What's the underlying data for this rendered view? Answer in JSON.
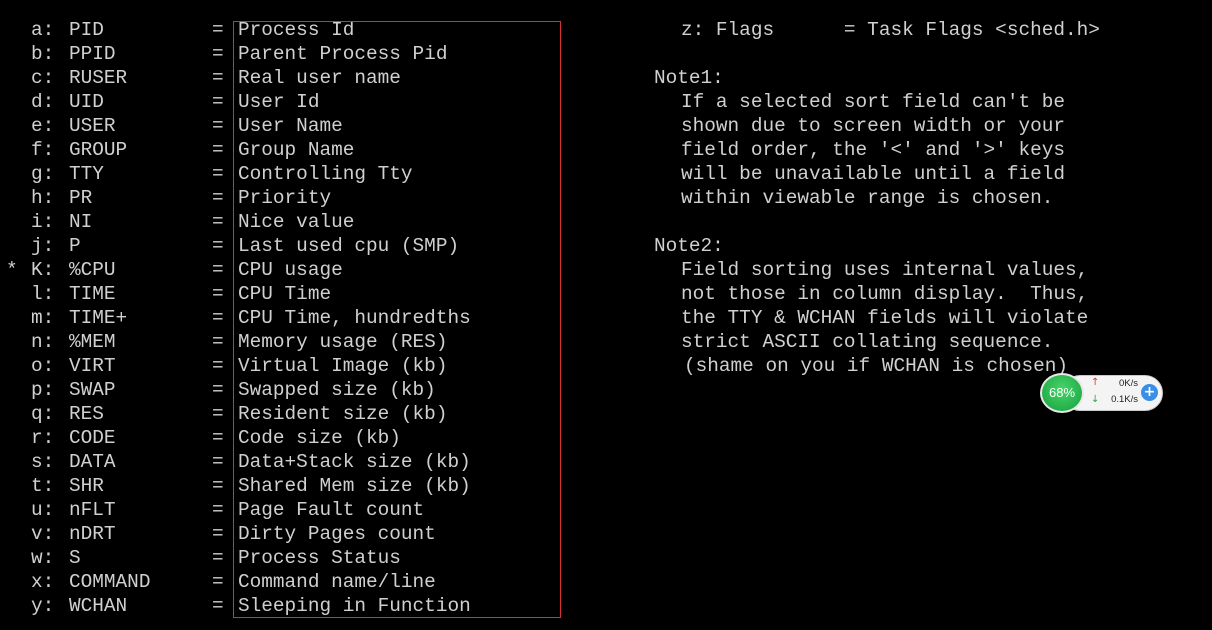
{
  "fields": [
    {
      "mark": "",
      "key": "a:",
      "name": "PID",
      "eq": "=",
      "desc": "Process Id"
    },
    {
      "mark": "",
      "key": "b:",
      "name": "PPID",
      "eq": "=",
      "desc": "Parent Process Pid"
    },
    {
      "mark": "",
      "key": "c:",
      "name": "RUSER",
      "eq": "=",
      "desc": "Real user name"
    },
    {
      "mark": "",
      "key": "d:",
      "name": "UID",
      "eq": "=",
      "desc": "User Id"
    },
    {
      "mark": "",
      "key": "e:",
      "name": "USER",
      "eq": "=",
      "desc": "User Name"
    },
    {
      "mark": "",
      "key": "f:",
      "name": "GROUP",
      "eq": "=",
      "desc": "Group Name"
    },
    {
      "mark": "",
      "key": "g:",
      "name": "TTY",
      "eq": "=",
      "desc": "Controlling Tty"
    },
    {
      "mark": "",
      "key": "h:",
      "name": "PR",
      "eq": "=",
      "desc": "Priority"
    },
    {
      "mark": "",
      "key": "i:",
      "name": "NI",
      "eq": "=",
      "desc": "Nice value"
    },
    {
      "mark": "",
      "key": "j:",
      "name": "P",
      "eq": "=",
      "desc": "Last used cpu (SMP)"
    },
    {
      "mark": "*",
      "key": "K:",
      "name": "%CPU",
      "eq": "=",
      "desc": "CPU usage"
    },
    {
      "mark": "",
      "key": "l:",
      "name": "TIME",
      "eq": "=",
      "desc": "CPU Time"
    },
    {
      "mark": "",
      "key": "m:",
      "name": "TIME+",
      "eq": "=",
      "desc": "CPU Time, hundredths"
    },
    {
      "mark": "",
      "key": "n:",
      "name": "%MEM",
      "eq": "=",
      "desc": "Memory usage (RES)"
    },
    {
      "mark": "",
      "key": "o:",
      "name": "VIRT",
      "eq": "=",
      "desc": "Virtual Image (kb)"
    },
    {
      "mark": "",
      "key": "p:",
      "name": "SWAP",
      "eq": "=",
      "desc": "Swapped size (kb)"
    },
    {
      "mark": "",
      "key": "q:",
      "name": "RES",
      "eq": "=",
      "desc": "Resident size (kb)"
    },
    {
      "mark": "",
      "key": "r:",
      "name": "CODE",
      "eq": "=",
      "desc": "Code size (kb)"
    },
    {
      "mark": "",
      "key": "s:",
      "name": "DATA",
      "eq": "=",
      "desc": "Data+Stack size (kb)"
    },
    {
      "mark": "",
      "key": "t:",
      "name": "SHR",
      "eq": "=",
      "desc": "Shared Mem size (kb)"
    },
    {
      "mark": "",
      "key": "u:",
      "name": "nFLT",
      "eq": "=",
      "desc": "Page Fault count"
    },
    {
      "mark": "",
      "key": "v:",
      "name": "nDRT",
      "eq": "=",
      "desc": "Dirty Pages count"
    },
    {
      "mark": "",
      "key": "w:",
      "name": "S",
      "eq": "=",
      "desc": "Process Status"
    },
    {
      "mark": "",
      "key": "x:",
      "name": "COMMAND",
      "eq": "=",
      "desc": "Command name/line"
    },
    {
      "mark": "",
      "key": "y:",
      "name": "WCHAN",
      "eq": "=",
      "desc": "Sleeping in Function"
    }
  ],
  "right": {
    "z_line": "z: Flags      = Task Flags <sched.h>",
    "note1_title": "Note1:",
    "note1_lines": [
      "If a selected sort field can't be",
      "shown due to screen width or your",
      "field order, the '<' and '>' keys",
      "will be unavailable until a field",
      "within viewable range is chosen."
    ],
    "note2_title": "Note2:",
    "note2_lines": [
      "Field sorting uses internal values,",
      "not those in column display.  Thus,",
      "the TTY & WCHAN fields will violate",
      "strict ASCII collating sequence.",
      "(shame on you if WCHAN is chosen)"
    ]
  },
  "net_widget": {
    "percent": "68%",
    "up_speed": "0K/s",
    "down_speed": "0.1K/s",
    "up_icon": "arrow-up-icon",
    "down_icon": "arrow-down-icon",
    "expand_icon": "plus-icon",
    "plus_label": "+"
  },
  "colors": {
    "background": "#000000",
    "text": "#d0d0d0",
    "highlight_border": "#d83030",
    "widget_green": "#23b04a",
    "widget_blue": "#3a8ee6"
  }
}
